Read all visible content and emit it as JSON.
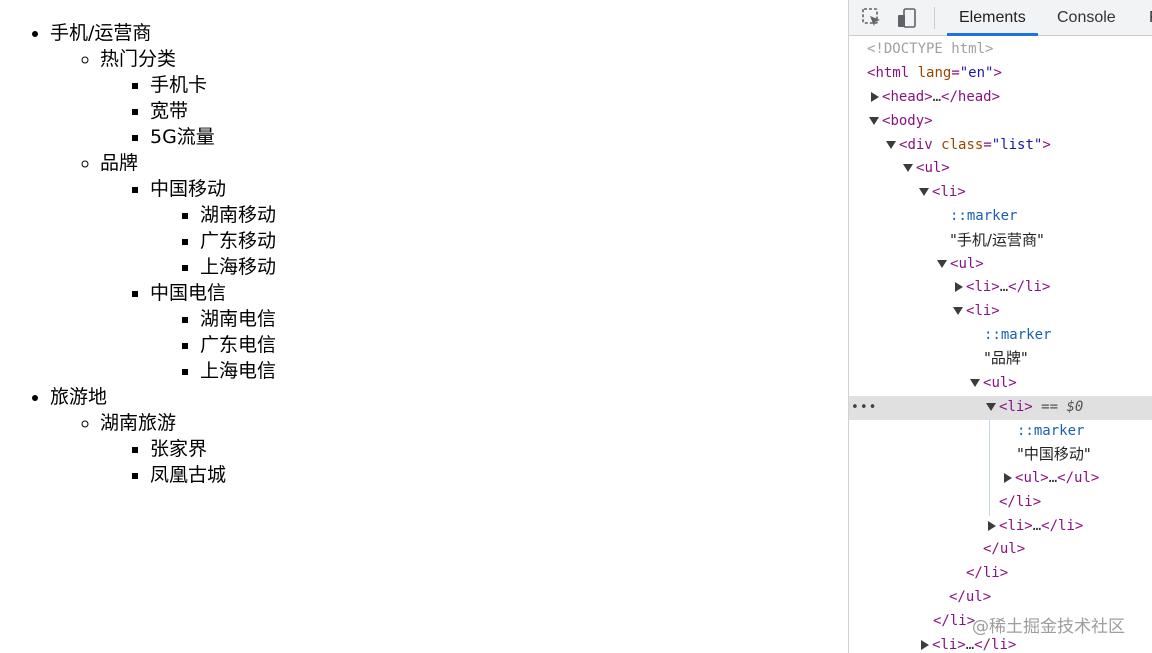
{
  "list": {
    "travel": "旅游地",
    "phone_carrier": {
      "label": "手机/运营商",
      "hot": {
        "label": "热门分类",
        "items": [
          "手机卡",
          "宽带",
          "5G流量"
        ]
      },
      "brand": {
        "label": "品牌",
        "mobile": {
          "label": "中国移动",
          "items": [
            "湖南移动",
            "广东移动",
            "上海移动"
          ]
        },
        "telecom": {
          "label": "中国电信",
          "items": [
            "湖南电信",
            "广东电信",
            "上海电信"
          ]
        }
      }
    },
    "hunan_travel": {
      "label": "湖南旅游",
      "items": [
        "张家界",
        "凤凰古城"
      ]
    }
  },
  "devtools": {
    "tabs": [
      "Elements",
      "Console",
      "F"
    ],
    "active_tab": "Elements",
    "accent": "#1a73e8",
    "icons": [
      "inspect-element-icon",
      "device-toolbar-icon"
    ],
    "dom": {
      "doctype": "<!DOCTYPE html>",
      "html_tag": "html",
      "lang_attr": "lang",
      "lang_val": "\"en\"",
      "head": "head",
      "body": "body",
      "div": "div",
      "class_attr": "class",
      "class_val": "\"list\"",
      "ul": "ul",
      "li": "li",
      "marker": "::marker",
      "text_phone": "\"手机/运营商\"",
      "text_brand": "\"品牌\"",
      "text_mobile": "\"中国移动\"",
      "selected_suffix": "== $0",
      "ellipsis": "…",
      "row_menu": "•••"
    }
  },
  "watermark": "@稀土掘金技术社区"
}
